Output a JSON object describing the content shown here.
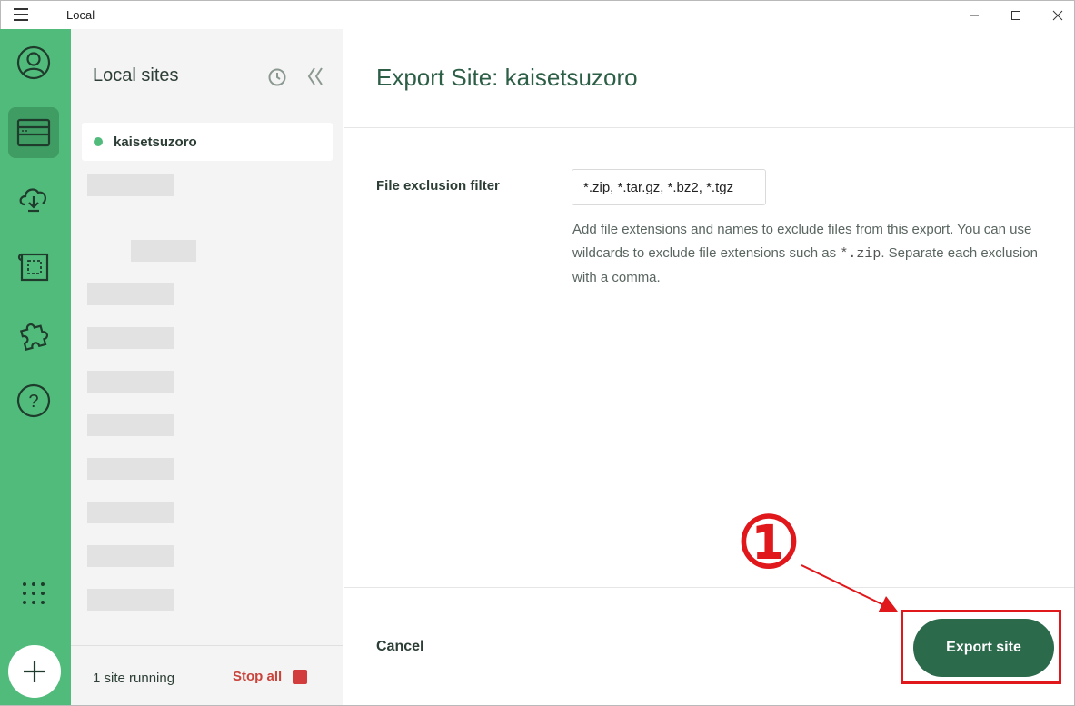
{
  "window": {
    "title": "Local",
    "controls": [
      "minimize-icon",
      "maximize-icon",
      "close-icon"
    ]
  },
  "rail": {
    "items": [
      {
        "name": "account-icon"
      },
      {
        "name": "local-sites-icon",
        "active": true
      },
      {
        "name": "cloud-icon"
      },
      {
        "name": "blueprints-icon"
      },
      {
        "name": "addons-icon"
      },
      {
        "name": "help-icon"
      }
    ],
    "apps_icon": "apps-grid-icon",
    "add_icon": "plus-icon",
    "accent": "#51bb7b"
  },
  "sites": {
    "title": "Local sites",
    "selected_site": "kaisetsuzoro",
    "running_text": "1 site running",
    "stop_all_label": "Stop all"
  },
  "main": {
    "title": "Export Site: kaisetsuzoro",
    "field_label": "File exclusion filter",
    "filter_value": "*.zip, *.tar.gz, *.bz2, *.tgz",
    "help_before": "Add file extensions and names to exclude files from this export. You can use wildcards to exclude file extensions such as ",
    "help_code": "*.zip",
    "help_after": ". Separate each exclusion with a comma.",
    "cancel_label": "Cancel",
    "export_label": "Export site"
  },
  "annotation": {
    "marker": "①",
    "color": "#e0171b"
  }
}
